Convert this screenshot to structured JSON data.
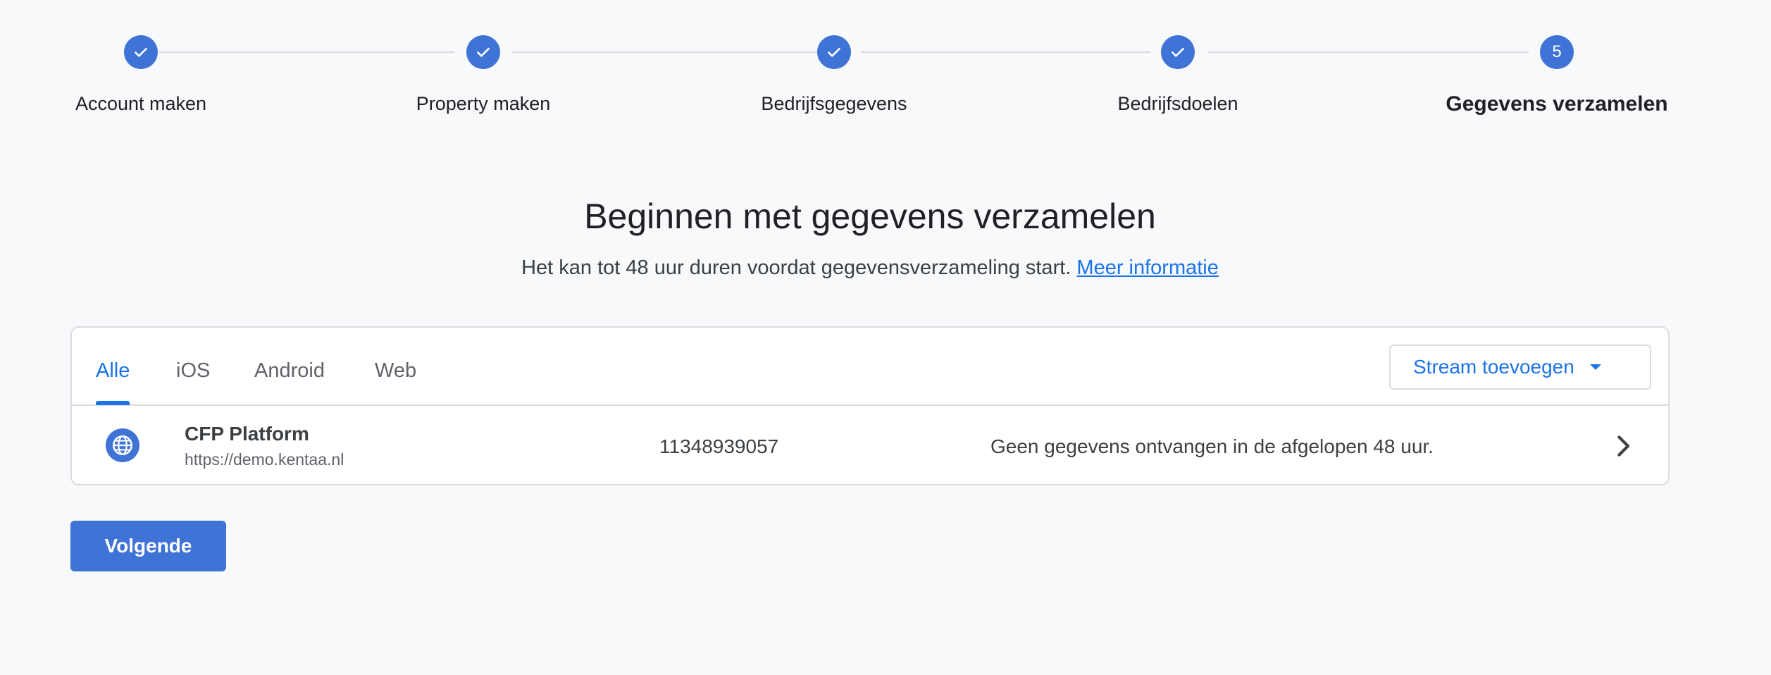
{
  "stepper": {
    "steps": [
      {
        "label": "Account maken",
        "state": "done"
      },
      {
        "label": "Property maken",
        "state": "done"
      },
      {
        "label": "Bedrijfsgegevens",
        "state": "done"
      },
      {
        "label": "Bedrijfsdoelen",
        "state": "done"
      },
      {
        "label": "Gegevens verzamelen",
        "state": "active",
        "number": "5"
      }
    ]
  },
  "header": {
    "title": "Beginnen met gegevens verzamelen",
    "subtitle": "Het kan tot 48 uur duren voordat gegevensverzameling start.",
    "learn_more": "Meer informatie"
  },
  "streams_card": {
    "tabs": [
      {
        "label": "Alle",
        "active": true
      },
      {
        "label": "iOS",
        "active": false
      },
      {
        "label": "Android",
        "active": false
      },
      {
        "label": "Web",
        "active": false
      }
    ],
    "add_stream_label": "Stream toevoegen",
    "rows": [
      {
        "icon": "globe-icon",
        "name": "CFP Platform",
        "url": "https://demo.kentaa.nl",
        "id": "11348939057",
        "status": "Geen gegevens ontvangen in de afgelopen 48 uur."
      }
    ]
  },
  "footer": {
    "next_label": "Volgende"
  },
  "colors": {
    "accent": "#1a73e8",
    "step_fill": "#3f73d6",
    "background": "#f8f9fb"
  }
}
